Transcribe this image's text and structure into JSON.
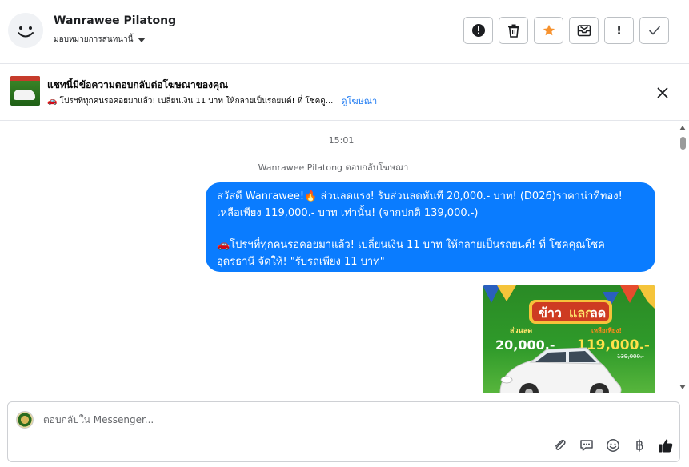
{
  "header": {
    "name": "Wanrawee Pilatong",
    "assign_label": "มอบหมายการสนทนานี้",
    "actions": [
      {
        "label": "!",
        "icon": "alert-circle-icon"
      },
      {
        "label": "",
        "icon": "trash-icon"
      },
      {
        "label": "",
        "icon": "star-icon",
        "color": "#f7922e"
      },
      {
        "label": "",
        "icon": "mail-archive-icon"
      },
      {
        "label": "!",
        "icon": "exclamation-icon"
      },
      {
        "label": "",
        "icon": "check-icon"
      }
    ]
  },
  "banner": {
    "title": "แชทนี้มีข้อความตอบกลับต่อโฆษณาของคุณ",
    "subtitle": "🚗 โปรฯที่ทุกคนรอคอยมาแล้ว! เปลี่ยนเงิน 11 บาท ให้กลายเป็นรถยนต์! ที่ โชคดู...",
    "link": "ดูโฆษณา"
  },
  "conversation": {
    "timestamp": "15:01",
    "reply_note": "Wanrawee Pilatong ตอบกลับโฆษณา",
    "message_lines": [
      "สวัสดี Wanrawee!🔥 ส่วนลดแรง! รับส่วนลดทันที 20,000.- บาท! (D026)ราคาน่าทีทอง!",
      "เหลือเพียง 119,000.- บาท เท่านั้น! (จากปกติ 139,000.-)",
      "🚗โปรฯที่ทุกคนรอคอยมาแล้ว! เปลี่ยนเงิน 11 บาท ให้กลายเป็นรถยนต์! ที่ โชคคุณโชค",
      "อุดรธานี จัดให้! \"รับรถเพียง 11 บาท\""
    ],
    "promo_image": {
      "headline_1": "ข้าว",
      "headline_2": "แลก",
      "headline_3": "ลด",
      "discount_label": "ส่วนลด",
      "discount_value": "20,000.-",
      "price_label": "เหลือเพียง!",
      "price_value": "119,000.-",
      "old_price": "139,000.-"
    }
  },
  "composer": {
    "placeholder": "ตอบกลับใน Messenger..."
  },
  "colors": {
    "accent": "#0a7cff",
    "link": "#1877f2",
    "star": "#f7922e"
  }
}
